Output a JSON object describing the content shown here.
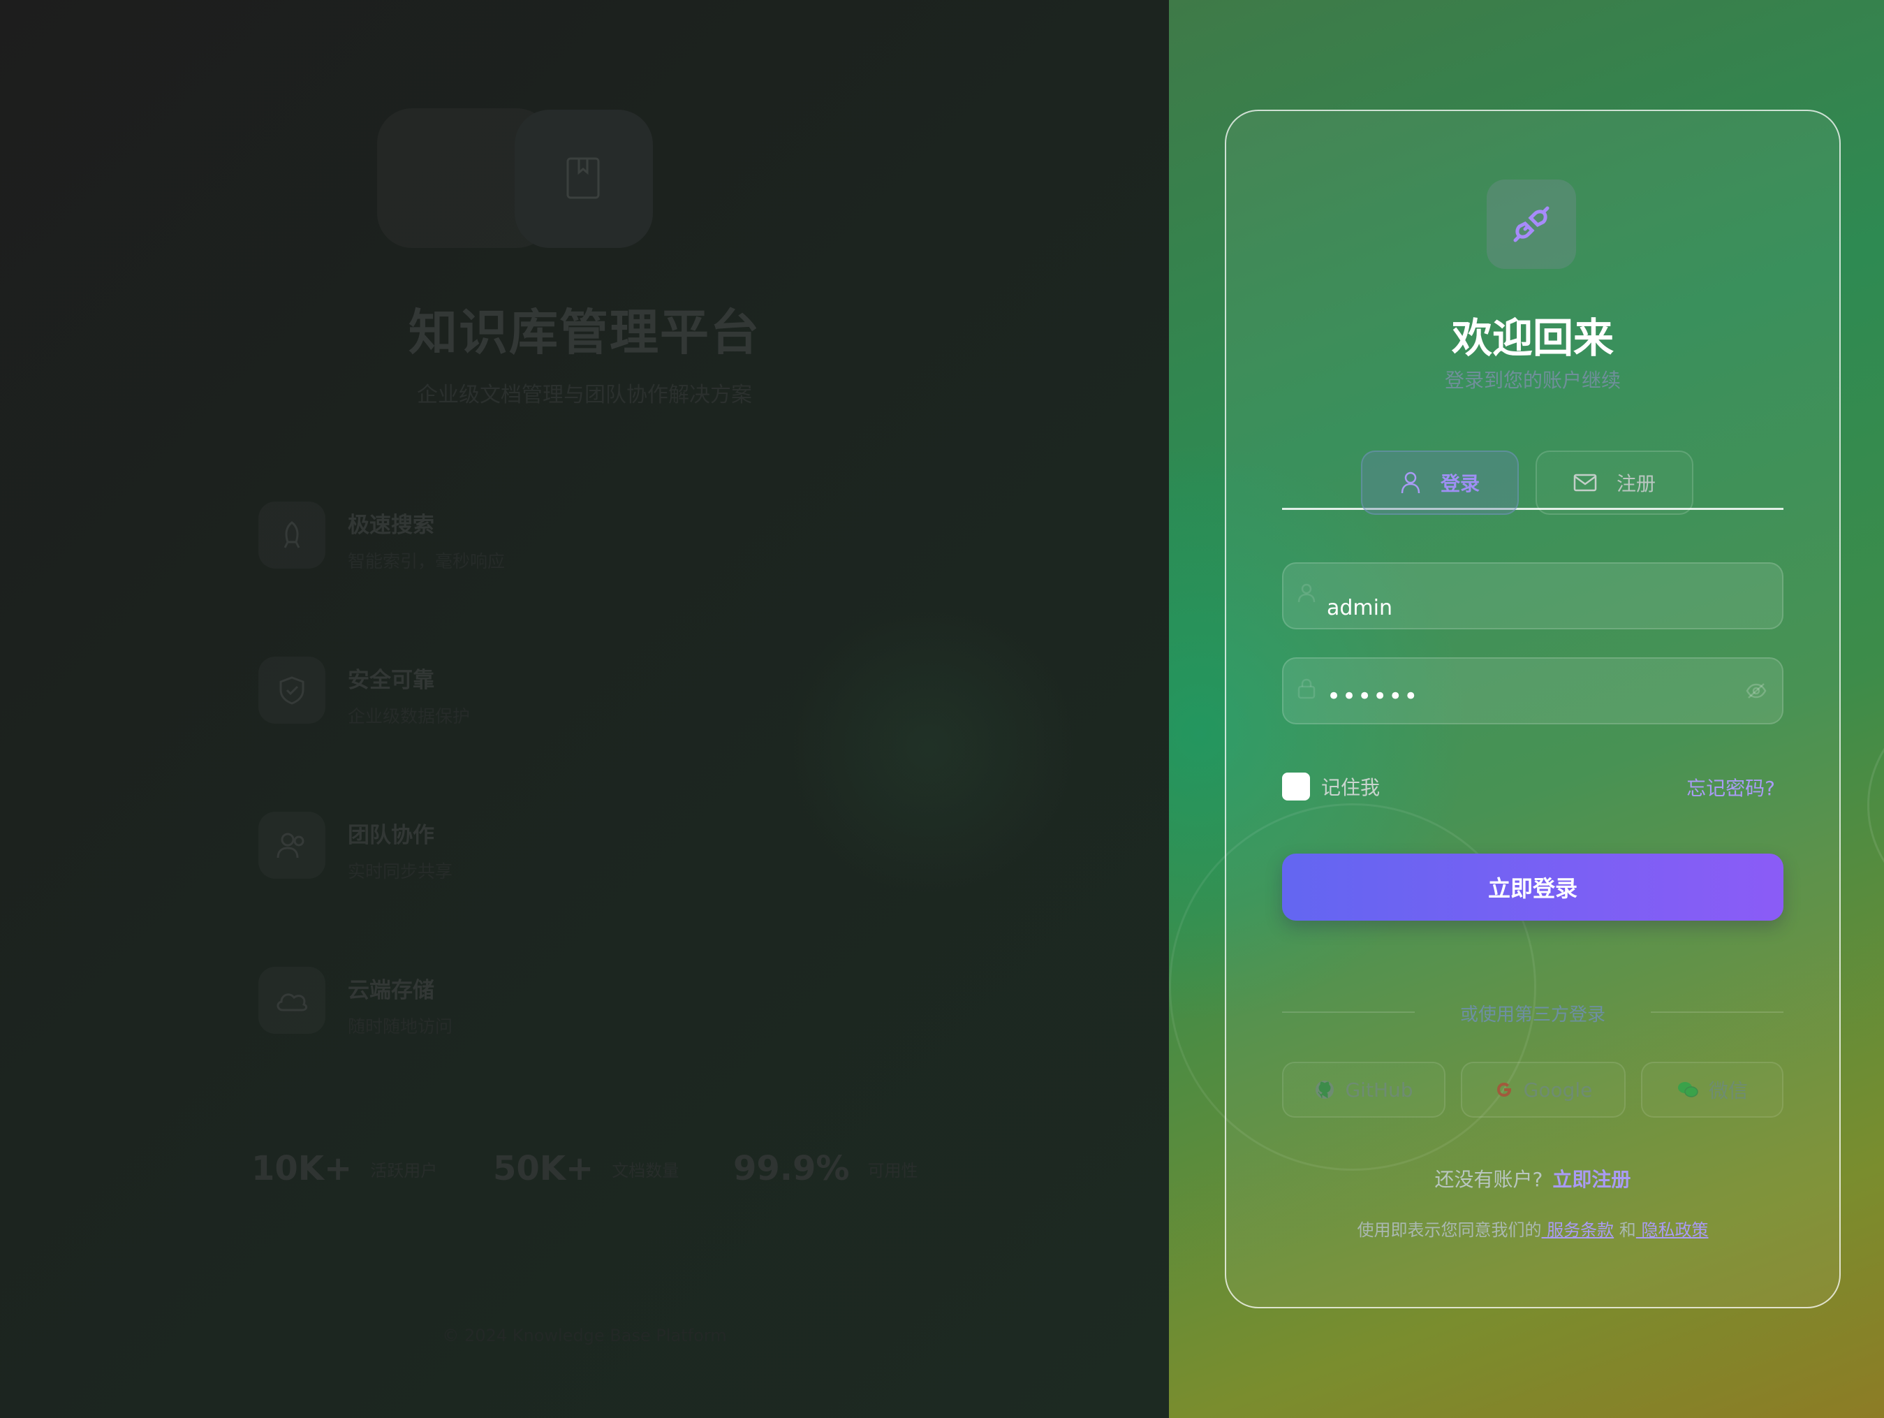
{
  "brand": {
    "title": "知识库管理平台",
    "subtitle": "企业级文档管理与团队协作解决方案"
  },
  "features": [
    {
      "title": "极速搜索",
      "desc": "智能索引，毫秒响应",
      "icon": "rocket-icon"
    },
    {
      "title": "安全可靠",
      "desc": "企业级数据保护",
      "icon": "shield-check-icon"
    },
    {
      "title": "团队协作",
      "desc": "实时同步共享",
      "icon": "users-icon"
    },
    {
      "title": "云端存储",
      "desc": "随时随地访问",
      "icon": "cloud-icon"
    }
  ],
  "stats": [
    {
      "value": "10K+",
      "label": "活跃用户"
    },
    {
      "value": "50K+",
      "label": "文档数量"
    },
    {
      "value": "99.9%",
      "label": "可用性"
    }
  ],
  "footer": {
    "copyright": "© 2024 Knowledge Base Platform"
  },
  "login": {
    "title": "欢迎回来",
    "subtitle": "登录到您的账户继续",
    "tabs": [
      {
        "label": "登录",
        "icon": "user-icon",
        "active": true
      },
      {
        "label": "注册",
        "icon": "mail-icon",
        "active": false
      }
    ],
    "username_value": "admin",
    "password_value": "••••••",
    "remember_label": "记住我",
    "remember_checked": false,
    "forgot_label": "忘记密码?",
    "submit_label": "立即登录",
    "divider_text": "或使用第三方登录",
    "social": [
      {
        "label": "GitHub",
        "icon": "github-icon"
      },
      {
        "label": "Google",
        "icon": "google-icon"
      },
      {
        "label": "微信",
        "icon": "wechat-icon"
      }
    ],
    "no_account_text": "还没有账户?",
    "register_link": "立即注册",
    "terms_prefix": "使用即表示您同意我们的",
    "terms_link": " 服务条款",
    "terms_and": " 和",
    "privacy_link": " 隐私政策"
  },
  "colors": {
    "accent": "#8b5cf6",
    "accent_start": "#6366f1",
    "link": "#a99bf5"
  }
}
